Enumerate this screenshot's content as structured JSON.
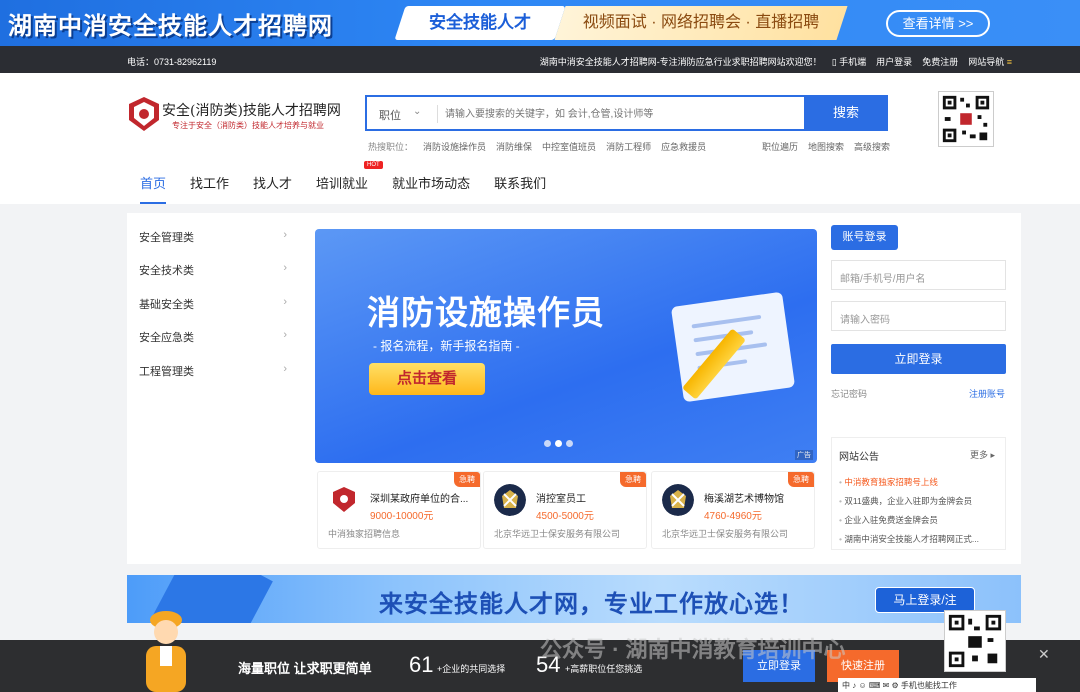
{
  "top_banner": {
    "title": "湖南中消安全技能人才招聘网",
    "pill1": "安全技能人才",
    "pill2": "视频面试 · 网络招聘会 · 直播招聘",
    "detail_button": "查看详情 >>"
  },
  "topbar": {
    "phone": "电话：0731-82962119",
    "welcome": "湖南中消安全技能人才招聘网-专注消防应急行业求职招聘网站欢迎您！",
    "mobile": "手机端",
    "user_login": "用户登录",
    "free_register": "免费注册",
    "site_nav": "网站导航"
  },
  "logo": {
    "title": "安全(消防类)技能人才招聘网",
    "subtitle": "专注于安全（消防类）技能人才培养与就业"
  },
  "search": {
    "category": "职位",
    "placeholder": "请输入要搜索的关键字，如 会计,仓管,设计师等",
    "button": "搜索"
  },
  "hot_jobs": {
    "label": "热搜职位：",
    "items": [
      "消防设施操作员",
      "消防维保",
      "中控室值班员",
      "消防工程师",
      "应急救援员"
    ]
  },
  "quick_links": [
    "职位遍历",
    "地图搜索",
    "高级搜索"
  ],
  "nav": {
    "items": [
      "首页",
      "找工作",
      "找人才",
      "培训就业",
      "就业市场动态",
      "联系我们"
    ],
    "hot_badge": "HOT"
  },
  "categories": [
    "安全管理类",
    "安全技术类",
    "基础安全类",
    "安全应急类",
    "工程管理类"
  ],
  "slider": {
    "headline": "消防设施操作员",
    "sub": "- 报名流程，新手报名指南 -",
    "cta": "点击查看",
    "ad_label": "广告"
  },
  "jobs": [
    {
      "tag": "急聘",
      "title": "深圳某政府单位的合...",
      "salary": "9000-10000元",
      "company": "中消独家招聘信息"
    },
    {
      "tag": "急聘",
      "title": "消控室员工",
      "salary": "4500-5000元",
      "company": "北京华远卫士保安服务有限公司"
    },
    {
      "tag": "急聘",
      "title": "梅溪湖艺术博物馆",
      "salary": "4760-4960元",
      "company": "北京华远卫士保安服务有限公司"
    }
  ],
  "login": {
    "tab": "账号登录",
    "user_placeholder": "邮箱/手机号/用户名",
    "pass_placeholder": "请输入密码",
    "button": "立即登录",
    "forgot": "忘记密码",
    "register": "注册账号"
  },
  "notice": {
    "title": "网站公告",
    "more": "更多",
    "items": [
      "中消教育独家招聘号上线",
      "双11盛典，企业入驻即为金牌会员",
      "企业入驻免费送金牌会员",
      "湖南中消安全技能人才招聘网正式..."
    ]
  },
  "banner2": {
    "text": "来安全技能人才网，专业工作放心选！",
    "button": "马上登录/注"
  },
  "sticky": {
    "slogan": "海量职位 让求职更简单",
    "num1": "61",
    "text1": "+企业的共同选择",
    "num2": "54",
    "text2": "+高薪职位任您挑选",
    "login": "立即登录",
    "register": "快速注册",
    "strip": "中 ♪ ☺ ⌨ ✉ ⚙  手机也能找工作",
    "close": "✕"
  },
  "watermark": "公众号 · 湖南中消教育培训中心",
  "colors": {
    "primary": "#2b6de3",
    "accent": "#f56a2c",
    "dark": "#2b2d33"
  }
}
